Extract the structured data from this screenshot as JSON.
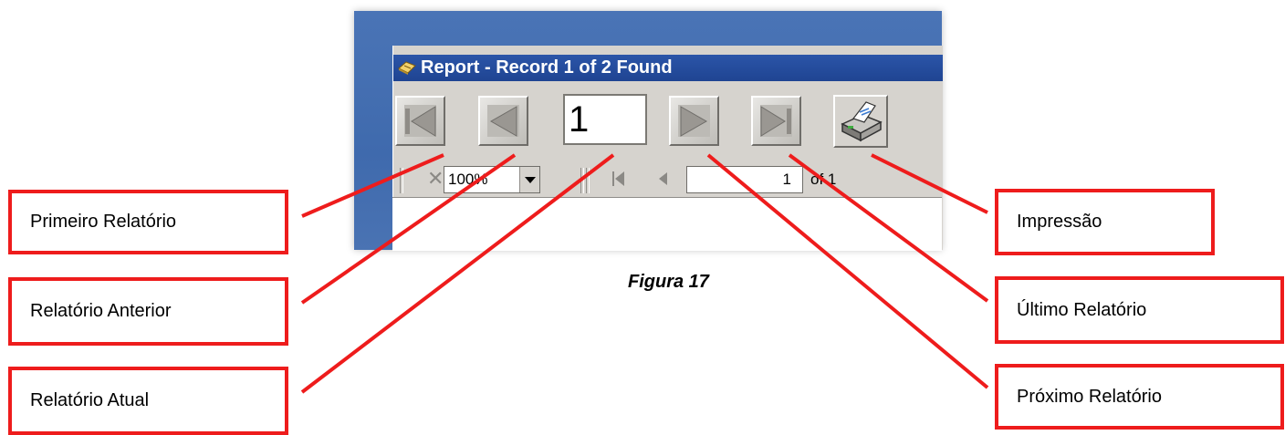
{
  "window": {
    "title": "Report - Record 1 of 2 Found",
    "current_record": "1",
    "zoom": "100%",
    "page_value": "1",
    "page_of": "of 1"
  },
  "callouts": {
    "first": "Primeiro Relatório",
    "previous": "Relatório Anterior",
    "current": "Relatório Atual",
    "print": "Impressão",
    "last": "Último Relatório",
    "next": "Próximo Relatório"
  },
  "caption": "Figura 17",
  "colors": {
    "callout_red": "#ee1c1c",
    "titlebar_blue": "#2b55a8",
    "desktop_blue": "#3f6aad"
  }
}
